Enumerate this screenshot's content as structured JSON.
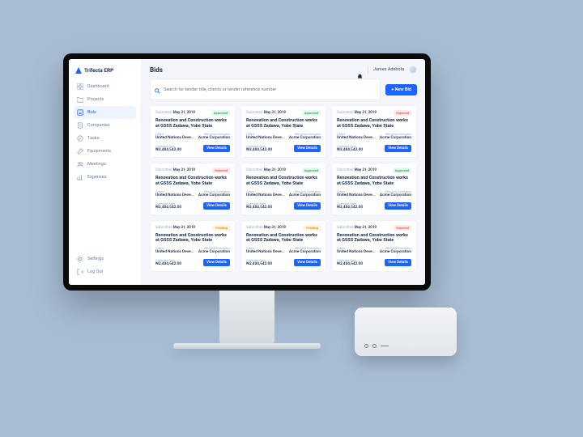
{
  "brand": {
    "name": "Trifecta ERP"
  },
  "sidebar": {
    "items": [
      {
        "label": "Dashboard"
      },
      {
        "label": "Projects"
      },
      {
        "label": "Bids"
      },
      {
        "label": "Companies"
      },
      {
        "label": "Tasks"
      },
      {
        "label": "Equipments"
      },
      {
        "label": "Meetings"
      },
      {
        "label": "Expenses"
      }
    ],
    "bottom": [
      {
        "label": "Settings"
      },
      {
        "label": "Log Out"
      }
    ]
  },
  "header": {
    "title": "Bids",
    "user": "James Adebola"
  },
  "search": {
    "placeholder": "Search for tender title, clients or tender reference number"
  },
  "actions": {
    "new_bid": "+ New Bid"
  },
  "card_labels": {
    "submitted": "Submitted",
    "client": "Client",
    "winning_company": "Winning Company",
    "contract_sum": "Contract Sum",
    "view_details": "View Details"
  },
  "status_labels": {
    "approved": "Approved",
    "rejected": "Rejected",
    "pending": "Pending"
  },
  "cards": [
    {
      "date": "May 31, 2019",
      "status": "approved",
      "title": "Renovation and Construction works at GSSS Zadawa, Yobe State",
      "client": "United Nations Deve...",
      "winner": "Acme Corporation",
      "sum": "₦3,484,542.00"
    },
    {
      "date": "May 31, 2019",
      "status": "approved",
      "title": "Renovation and Construction works at GSSS Zadawa, Yobe State",
      "client": "United Nations Deve...",
      "winner": "Acme Corporation",
      "sum": "₦3,484,542.00"
    },
    {
      "date": "May 31, 2019",
      "status": "rejected",
      "title": "Renovation and Construction works at GSSS Zadawa, Yobe State",
      "client": "United Nations Deve...",
      "winner": "Acme Corporation",
      "sum": "₦3,484,542.00"
    },
    {
      "date": "May 31, 2019",
      "status": "rejected",
      "title": "Renovation and Construction works at GSSS Zadawa, Yobe State",
      "client": "United Nations Deve...",
      "winner": "Acme Corporation",
      "sum": "₦3,484,542.00"
    },
    {
      "date": "May 31, 2019",
      "status": "approved",
      "title": "Renovation and Construction works at GSSS Zadawa, Yobe State",
      "client": "United Nations Deve...",
      "winner": "Acme Corporation",
      "sum": "₦3,484,542.00"
    },
    {
      "date": "May 31, 2019",
      "status": "approved",
      "title": "Renovation and Construction works at GSSS Zadawa, Yobe State",
      "client": "United Nations Deve...",
      "winner": "Acme Corporation",
      "sum": "₦3,484,542.00"
    },
    {
      "date": "May 31, 2019",
      "status": "pending",
      "title": "Renovation and Construction works at GSSS Zadawa, Yobe State",
      "client": "United Nations Deve...",
      "winner": "Acme Corporation",
      "sum": "₦3,484,542.00"
    },
    {
      "date": "May 31, 2019",
      "status": "pending",
      "title": "Renovation and Construction works at GSSS Zadawa, Yobe State",
      "client": "United Nations Deve...",
      "winner": "Acme Corporation",
      "sum": "₦3,484,542.00"
    },
    {
      "date": "May 31, 2019",
      "status": "rejected",
      "title": "Renovation and Construction works at GSSS Zadawa, Yobe State",
      "client": "United Nations Deve...",
      "winner": "Acme Corporation",
      "sum": "₦3,484,542.00"
    }
  ]
}
